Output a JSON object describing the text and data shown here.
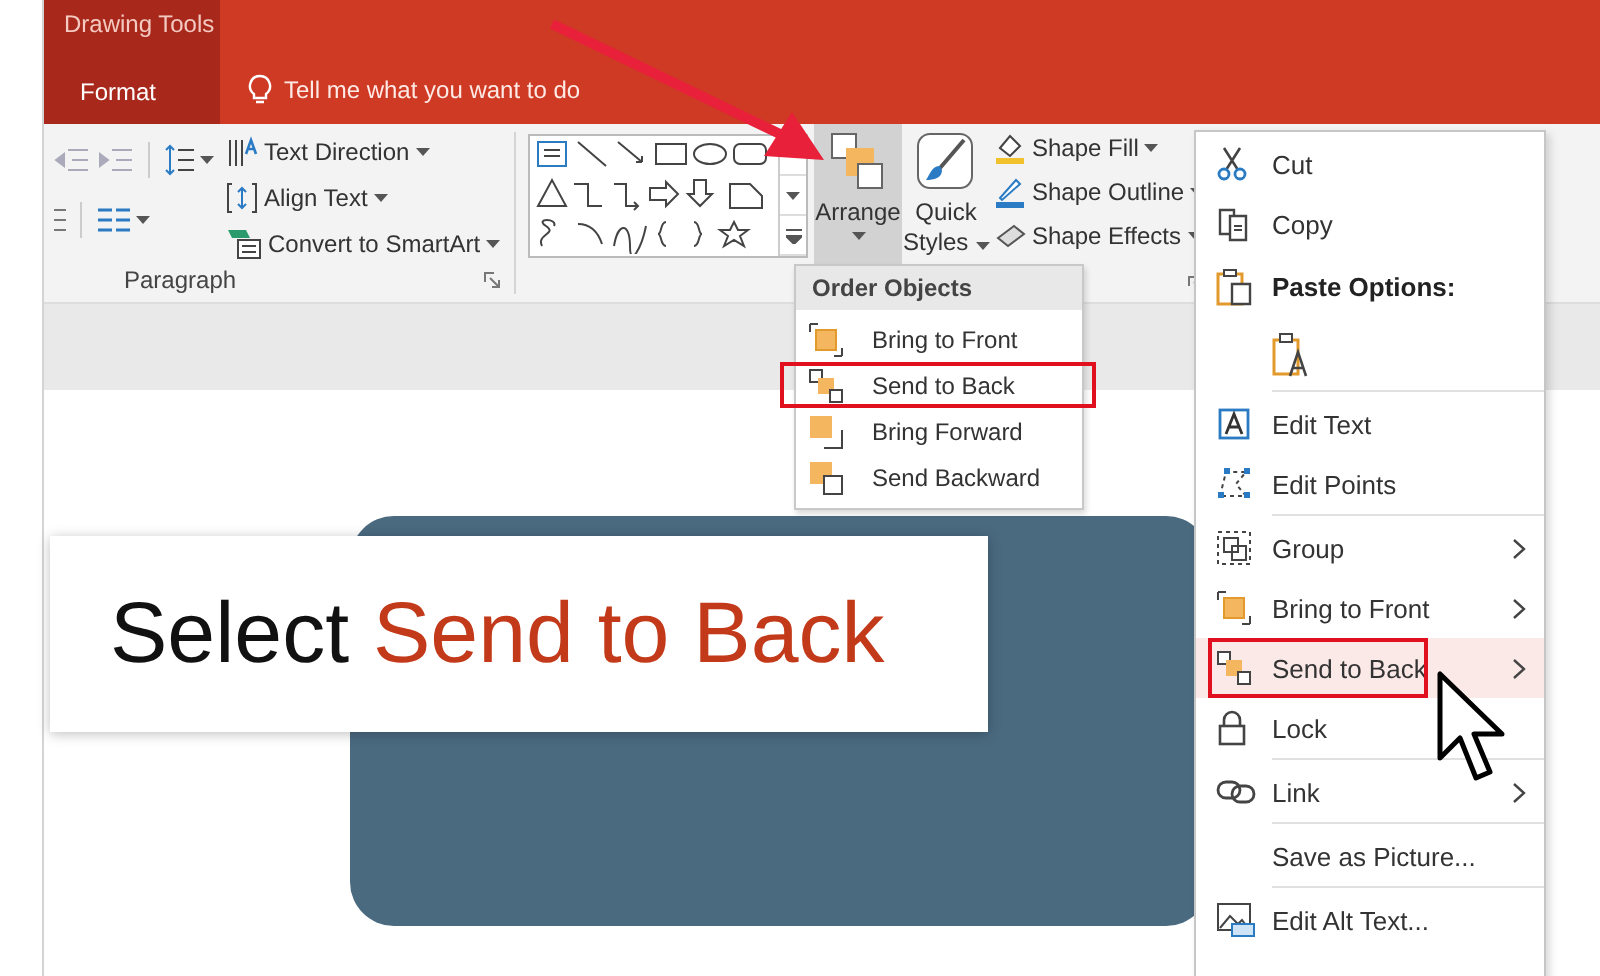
{
  "ribbon": {
    "context_label": "Drawing Tools",
    "tabs": [
      {
        "label": "Format",
        "selected": true
      }
    ],
    "tell_me": "Tell me what you want to do"
  },
  "paragraph_group": {
    "label": "Paragraph",
    "buttons": [
      {
        "label": "Text Direction"
      },
      {
        "label": "Align Text"
      },
      {
        "label": "Convert to SmartArt"
      }
    ]
  },
  "arrange": {
    "label": "Arrange",
    "pressed": true
  },
  "quick_styles": {
    "label": "Quick Styles"
  },
  "shape_format": [
    {
      "label": "Shape Fill"
    },
    {
      "label": "Shape Outline"
    },
    {
      "label": "Shape Effects"
    }
  ],
  "order_menu": {
    "title": "Order Objects",
    "items": [
      {
        "label": "Bring to Front",
        "outlined": false
      },
      {
        "label": "Send to Back",
        "outlined": true
      },
      {
        "label": "Bring Forward",
        "outlined": false
      },
      {
        "label": "Send Backward",
        "outlined": false
      }
    ]
  },
  "callout": {
    "prefix": "Select",
    "highlight": "Send to Back"
  },
  "context_menu": [
    {
      "kind": "item",
      "label": "Cut",
      "submenu": false,
      "selected": false,
      "outlined": false
    },
    {
      "kind": "item",
      "label": "Copy",
      "submenu": false,
      "selected": false,
      "outlined": false
    },
    {
      "kind": "header",
      "label": "Paste Options:"
    },
    {
      "kind": "paste-option"
    },
    {
      "kind": "item",
      "label": "Edit Text",
      "submenu": false,
      "selected": false,
      "outlined": false
    },
    {
      "kind": "item",
      "label": "Edit Points",
      "submenu": false,
      "selected": false,
      "outlined": false
    },
    {
      "kind": "item",
      "label": "Group",
      "submenu": true,
      "selected": false,
      "outlined": false
    },
    {
      "kind": "item",
      "label": "Bring to Front",
      "submenu": true,
      "selected": false,
      "outlined": false
    },
    {
      "kind": "item",
      "label": "Send to Back",
      "submenu": true,
      "selected": true,
      "outlined": true
    },
    {
      "kind": "item",
      "label": "Lock",
      "submenu": false,
      "selected": false,
      "outlined": false
    },
    {
      "kind": "item",
      "label": "Link",
      "submenu": true,
      "selected": false,
      "outlined": false
    },
    {
      "kind": "item",
      "label": "Save as Picture...",
      "submenu": false,
      "selected": false,
      "outlined": false
    },
    {
      "kind": "item",
      "label": "Edit Alt Text...",
      "submenu": false,
      "selected": false,
      "outlined": false
    }
  ]
}
